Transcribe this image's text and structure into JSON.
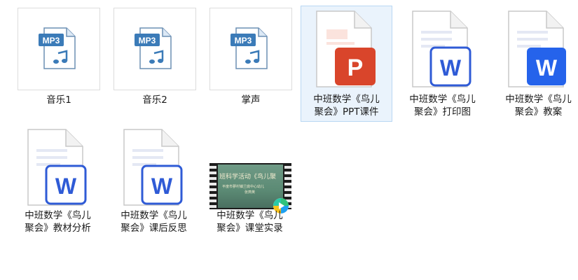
{
  "files": [
    {
      "name": "音乐1",
      "type": "mp3",
      "icon": "mp3-file-icon",
      "badge": "MP3"
    },
    {
      "name": "音乐2",
      "type": "mp3",
      "icon": "mp3-file-icon",
      "badge": "MP3"
    },
    {
      "name": "掌声",
      "type": "mp3",
      "icon": "mp3-file-icon",
      "badge": "MP3"
    },
    {
      "name": "中班数学《鸟儿聚会》PPT课件",
      "line1": "中班数学《鸟儿",
      "line2": "聚会》PPT课件",
      "type": "pptx",
      "icon": "powerpoint-file-icon",
      "badge": "P",
      "selected": true
    },
    {
      "name": "中班数学《鸟儿聚会》打印图",
      "line1": "中班数学《鸟儿",
      "line2": "聚会》打印图",
      "type": "docx",
      "icon": "word-file-icon",
      "badge": "W"
    },
    {
      "name": "中班数学《鸟儿聚会》教案",
      "line1": "中班数学《鸟儿",
      "line2": "聚会》教案",
      "type": "docx",
      "icon": "word-file-icon",
      "badge": "W"
    },
    {
      "name": "中班数学《鸟儿聚会》教材分析",
      "line1": "中班数学《鸟儿",
      "line2": "聚会》教材分析",
      "type": "docx",
      "icon": "word-file-icon",
      "badge": "W"
    },
    {
      "name": "中班数学《鸟儿聚会》课后反思",
      "line1": "中班数学《鸟儿",
      "line2": "聚会》课后反思",
      "type": "docx",
      "icon": "word-file-icon",
      "badge": "W"
    },
    {
      "name": "中班数学《鸟儿聚会》课堂实录",
      "line1": "中班数学《鸟儿",
      "line2": "聚会》课堂实录",
      "type": "video",
      "icon": "video-file-icon",
      "thumbnail_text_1": "班科学活动《鸟儿聚",
      "thumbnail_text_2": "平度市蓼村镇兰底中心幼儿",
      "thumbnail_text_3": "张燕英"
    }
  ],
  "colors": {
    "selection_bg": "#eaf3fc",
    "selection_border": "#b9d7f3",
    "ppt_red": "#d9452b",
    "word_blue": "#2f5bd6",
    "word_blue_bright": "#2563eb",
    "mp3_blue": "#3b7bb8"
  }
}
